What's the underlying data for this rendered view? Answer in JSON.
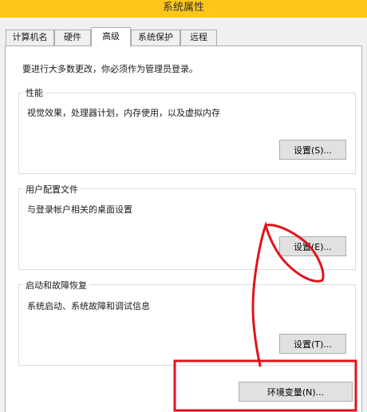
{
  "window": {
    "title": "系统属性"
  },
  "tabs": [
    {
      "label": "计算机名"
    },
    {
      "label": "硬件"
    },
    {
      "label": "高级"
    },
    {
      "label": "系统保护"
    },
    {
      "label": "远程"
    }
  ],
  "active_tab": "高级",
  "notice": "要进行大多数更改，你必须作为管理员登录。",
  "groups": {
    "performance": {
      "title": "性能",
      "desc": "视觉效果，处理器计划，内存使用，以及虚拟内存",
      "button": "设置(S)..."
    },
    "profiles": {
      "title": "用户配置文件",
      "desc": "与登录帐户相关的桌面设置",
      "button": "设置(E)..."
    },
    "startup": {
      "title": "启动和故障恢复",
      "desc": "系统启动、系统故障和调试信息",
      "button": "设置(T)..."
    }
  },
  "env_button": "环境变量(N)...",
  "colors": {
    "titlebar": "#ffc51a",
    "annotation": "#e0141b",
    "panel": "#ffffff"
  }
}
